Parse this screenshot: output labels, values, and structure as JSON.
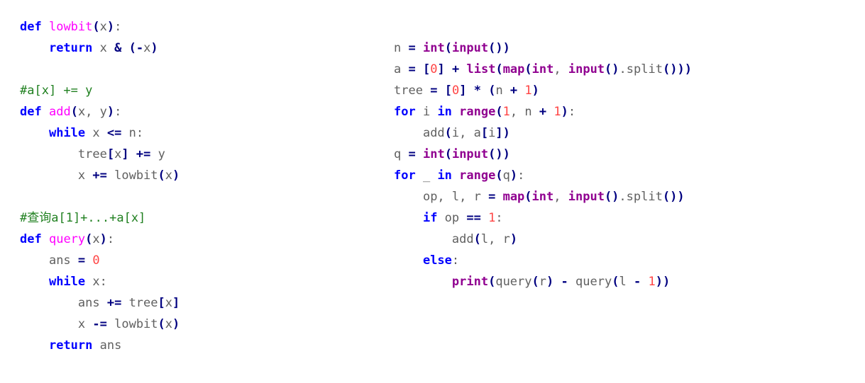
{
  "document": {
    "kind": "python-source-listing",
    "language": "Python",
    "background_color": "#ffffff",
    "columns": 2
  },
  "theme": {
    "keyword_color": "#0000ff",
    "definition_color": "#ff00ff",
    "builtin_color": "#900090",
    "comment_color": "#208020",
    "number_color": "#ff4444",
    "operator_color": "#000080",
    "plain_color": "#606060",
    "background_color": "#ffffff"
  },
  "left_column": {
    "name": "fenwick-tree-functions",
    "lines": [
      {
        "indent": 0,
        "tokens": [
          {
            "t": "def",
            "c": "kw"
          },
          {
            "t": " ",
            "c": "ws"
          },
          {
            "t": "lowbit",
            "c": "def"
          },
          {
            "t": "(",
            "c": "op"
          },
          {
            "t": "x",
            "c": "pl"
          },
          {
            "t": ")",
            "c": "op"
          },
          {
            "t": ":",
            "c": "pl"
          }
        ]
      },
      {
        "indent": 4,
        "tokens": [
          {
            "t": "return",
            "c": "kw"
          },
          {
            "t": " x ",
            "c": "pl"
          },
          {
            "t": "&",
            "c": "op"
          },
          {
            "t": " ",
            "c": "pl"
          },
          {
            "t": "(",
            "c": "op"
          },
          {
            "t": "-",
            "c": "op"
          },
          {
            "t": "x",
            "c": "pl"
          },
          {
            "t": ")",
            "c": "op"
          }
        ]
      },
      {
        "indent": 0,
        "tokens": []
      },
      {
        "indent": 0,
        "tokens": [
          {
            "t": "#a[x] += y",
            "c": "com"
          }
        ]
      },
      {
        "indent": 0,
        "tokens": [
          {
            "t": "def",
            "c": "kw"
          },
          {
            "t": " ",
            "c": "ws"
          },
          {
            "t": "add",
            "c": "def"
          },
          {
            "t": "(",
            "c": "op"
          },
          {
            "t": "x, y",
            "c": "pl"
          },
          {
            "t": ")",
            "c": "op"
          },
          {
            "t": ":",
            "c": "pl"
          }
        ]
      },
      {
        "indent": 4,
        "tokens": [
          {
            "t": "while",
            "c": "kw"
          },
          {
            "t": " x ",
            "c": "pl"
          },
          {
            "t": "<=",
            "c": "op"
          },
          {
            "t": " n:",
            "c": "pl"
          }
        ]
      },
      {
        "indent": 8,
        "tokens": [
          {
            "t": "tree",
            "c": "pl"
          },
          {
            "t": "[",
            "c": "op"
          },
          {
            "t": "x",
            "c": "pl"
          },
          {
            "t": "]",
            "c": "op"
          },
          {
            "t": " ",
            "c": "pl"
          },
          {
            "t": "+=",
            "c": "op"
          },
          {
            "t": " y",
            "c": "pl"
          }
        ]
      },
      {
        "indent": 8,
        "tokens": [
          {
            "t": "x ",
            "c": "pl"
          },
          {
            "t": "+=",
            "c": "op"
          },
          {
            "t": " ",
            "c": "pl"
          },
          {
            "t": "lowbit",
            "c": "pl"
          },
          {
            "t": "(",
            "c": "op"
          },
          {
            "t": "x",
            "c": "pl"
          },
          {
            "t": ")",
            "c": "op"
          }
        ]
      },
      {
        "indent": 0,
        "tokens": []
      },
      {
        "indent": 0,
        "tokens": [
          {
            "t": "#查询a[1]+...+a[x]",
            "c": "com"
          }
        ]
      },
      {
        "indent": 0,
        "tokens": [
          {
            "t": "def",
            "c": "kw"
          },
          {
            "t": " ",
            "c": "ws"
          },
          {
            "t": "query",
            "c": "def"
          },
          {
            "t": "(",
            "c": "op"
          },
          {
            "t": "x",
            "c": "pl"
          },
          {
            "t": ")",
            "c": "op"
          },
          {
            "t": ":",
            "c": "pl"
          }
        ]
      },
      {
        "indent": 4,
        "tokens": [
          {
            "t": "ans ",
            "c": "pl"
          },
          {
            "t": "=",
            "c": "op"
          },
          {
            "t": " ",
            "c": "pl"
          },
          {
            "t": "0",
            "c": "num"
          }
        ]
      },
      {
        "indent": 4,
        "tokens": [
          {
            "t": "while",
            "c": "kw"
          },
          {
            "t": " x:",
            "c": "pl"
          }
        ]
      },
      {
        "indent": 8,
        "tokens": [
          {
            "t": "ans ",
            "c": "pl"
          },
          {
            "t": "+=",
            "c": "op"
          },
          {
            "t": " tree",
            "c": "pl"
          },
          {
            "t": "[",
            "c": "op"
          },
          {
            "t": "x",
            "c": "pl"
          },
          {
            "t": "]",
            "c": "op"
          }
        ]
      },
      {
        "indent": 8,
        "tokens": [
          {
            "t": "x ",
            "c": "pl"
          },
          {
            "t": "-=",
            "c": "op"
          },
          {
            "t": " ",
            "c": "pl"
          },
          {
            "t": "lowbit",
            "c": "pl"
          },
          {
            "t": "(",
            "c": "op"
          },
          {
            "t": "x",
            "c": "pl"
          },
          {
            "t": ")",
            "c": "op"
          }
        ]
      },
      {
        "indent": 4,
        "tokens": [
          {
            "t": "return",
            "c": "kw"
          },
          {
            "t": " ans",
            "c": "pl"
          }
        ]
      }
    ]
  },
  "right_column": {
    "name": "fenwick-tree-main-driver",
    "lines": [
      {
        "indent": 0,
        "tokens": [
          {
            "t": "n ",
            "c": "pl"
          },
          {
            "t": "=",
            "c": "op"
          },
          {
            "t": " ",
            "c": "pl"
          },
          {
            "t": "int",
            "c": "bi"
          },
          {
            "t": "(",
            "c": "op"
          },
          {
            "t": "input",
            "c": "bi"
          },
          {
            "t": "()",
            "c": "op"
          },
          {
            "t": ")",
            "c": "op"
          }
        ]
      },
      {
        "indent": 0,
        "tokens": [
          {
            "t": "a ",
            "c": "pl"
          },
          {
            "t": "=",
            "c": "op"
          },
          {
            "t": " ",
            "c": "pl"
          },
          {
            "t": "[",
            "c": "op"
          },
          {
            "t": "0",
            "c": "num"
          },
          {
            "t": "]",
            "c": "op"
          },
          {
            "t": " ",
            "c": "pl"
          },
          {
            "t": "+",
            "c": "op"
          },
          {
            "t": " ",
            "c": "pl"
          },
          {
            "t": "list",
            "c": "bi"
          },
          {
            "t": "(",
            "c": "op"
          },
          {
            "t": "map",
            "c": "bi"
          },
          {
            "t": "(",
            "c": "op"
          },
          {
            "t": "int",
            "c": "bi"
          },
          {
            "t": ", ",
            "c": "pl"
          },
          {
            "t": "input",
            "c": "bi"
          },
          {
            "t": "()",
            "c": "op"
          },
          {
            "t": ".",
            "c": "pl"
          },
          {
            "t": "split",
            "c": "pl"
          },
          {
            "t": "()",
            "c": "op"
          },
          {
            "t": ")",
            "c": "op"
          },
          {
            "t": ")",
            "c": "op"
          }
        ]
      },
      {
        "indent": 0,
        "tokens": [
          {
            "t": "tree ",
            "c": "pl"
          },
          {
            "t": "=",
            "c": "op"
          },
          {
            "t": " ",
            "c": "pl"
          },
          {
            "t": "[",
            "c": "op"
          },
          {
            "t": "0",
            "c": "num"
          },
          {
            "t": "]",
            "c": "op"
          },
          {
            "t": " ",
            "c": "pl"
          },
          {
            "t": "*",
            "c": "op"
          },
          {
            "t": " ",
            "c": "pl"
          },
          {
            "t": "(",
            "c": "op"
          },
          {
            "t": "n ",
            "c": "pl"
          },
          {
            "t": "+",
            "c": "op"
          },
          {
            "t": " ",
            "c": "pl"
          },
          {
            "t": "1",
            "c": "num"
          },
          {
            "t": ")",
            "c": "op"
          }
        ]
      },
      {
        "indent": 0,
        "tokens": [
          {
            "t": "for",
            "c": "kw"
          },
          {
            "t": " i ",
            "c": "pl"
          },
          {
            "t": "in",
            "c": "kw"
          },
          {
            "t": " ",
            "c": "pl"
          },
          {
            "t": "range",
            "c": "bi"
          },
          {
            "t": "(",
            "c": "op"
          },
          {
            "t": "1",
            "c": "num"
          },
          {
            "t": ", n ",
            "c": "pl"
          },
          {
            "t": "+",
            "c": "op"
          },
          {
            "t": " ",
            "c": "pl"
          },
          {
            "t": "1",
            "c": "num"
          },
          {
            "t": ")",
            "c": "op"
          },
          {
            "t": ":",
            "c": "pl"
          }
        ]
      },
      {
        "indent": 4,
        "tokens": [
          {
            "t": "add",
            "c": "pl"
          },
          {
            "t": "(",
            "c": "op"
          },
          {
            "t": "i, a",
            "c": "pl"
          },
          {
            "t": "[",
            "c": "op"
          },
          {
            "t": "i",
            "c": "pl"
          },
          {
            "t": "]",
            "c": "op"
          },
          {
            "t": ")",
            "c": "op"
          }
        ]
      },
      {
        "indent": 0,
        "tokens": [
          {
            "t": "q ",
            "c": "pl"
          },
          {
            "t": "=",
            "c": "op"
          },
          {
            "t": " ",
            "c": "pl"
          },
          {
            "t": "int",
            "c": "bi"
          },
          {
            "t": "(",
            "c": "op"
          },
          {
            "t": "input",
            "c": "bi"
          },
          {
            "t": "()",
            "c": "op"
          },
          {
            "t": ")",
            "c": "op"
          }
        ]
      },
      {
        "indent": 0,
        "tokens": [
          {
            "t": "for",
            "c": "kw"
          },
          {
            "t": " _ ",
            "c": "pl"
          },
          {
            "t": "in",
            "c": "kw"
          },
          {
            "t": " ",
            "c": "pl"
          },
          {
            "t": "range",
            "c": "bi"
          },
          {
            "t": "(",
            "c": "op"
          },
          {
            "t": "q",
            "c": "pl"
          },
          {
            "t": ")",
            "c": "op"
          },
          {
            "t": ":",
            "c": "pl"
          }
        ]
      },
      {
        "indent": 4,
        "tokens": [
          {
            "t": "op, l, r ",
            "c": "pl"
          },
          {
            "t": "=",
            "c": "op"
          },
          {
            "t": " ",
            "c": "pl"
          },
          {
            "t": "map",
            "c": "bi"
          },
          {
            "t": "(",
            "c": "op"
          },
          {
            "t": "int",
            "c": "bi"
          },
          {
            "t": ", ",
            "c": "pl"
          },
          {
            "t": "input",
            "c": "bi"
          },
          {
            "t": "()",
            "c": "op"
          },
          {
            "t": ".",
            "c": "pl"
          },
          {
            "t": "split",
            "c": "pl"
          },
          {
            "t": "()",
            "c": "op"
          },
          {
            "t": ")",
            "c": "op"
          }
        ]
      },
      {
        "indent": 4,
        "tokens": [
          {
            "t": "if",
            "c": "kw"
          },
          {
            "t": " op ",
            "c": "pl"
          },
          {
            "t": "==",
            "c": "op"
          },
          {
            "t": " ",
            "c": "pl"
          },
          {
            "t": "1",
            "c": "num"
          },
          {
            "t": ":",
            "c": "pl"
          }
        ]
      },
      {
        "indent": 8,
        "tokens": [
          {
            "t": "add",
            "c": "pl"
          },
          {
            "t": "(",
            "c": "op"
          },
          {
            "t": "l, r",
            "c": "pl"
          },
          {
            "t": ")",
            "c": "op"
          }
        ]
      },
      {
        "indent": 4,
        "tokens": [
          {
            "t": "else",
            "c": "kw"
          },
          {
            "t": ":",
            "c": "pl"
          }
        ]
      },
      {
        "indent": 8,
        "tokens": [
          {
            "t": "print",
            "c": "bi"
          },
          {
            "t": "(",
            "c": "op"
          },
          {
            "t": "query",
            "c": "pl"
          },
          {
            "t": "(",
            "c": "op"
          },
          {
            "t": "r",
            "c": "pl"
          },
          {
            "t": ")",
            "c": "op"
          },
          {
            "t": " ",
            "c": "pl"
          },
          {
            "t": "-",
            "c": "op"
          },
          {
            "t": " ",
            "c": "pl"
          },
          {
            "t": "query",
            "c": "pl"
          },
          {
            "t": "(",
            "c": "op"
          },
          {
            "t": "l ",
            "c": "pl"
          },
          {
            "t": "-",
            "c": "op"
          },
          {
            "t": " ",
            "c": "pl"
          },
          {
            "t": "1",
            "c": "num"
          },
          {
            "t": ")",
            "c": "op"
          },
          {
            "t": ")",
            "c": "op"
          }
        ]
      }
    ]
  }
}
